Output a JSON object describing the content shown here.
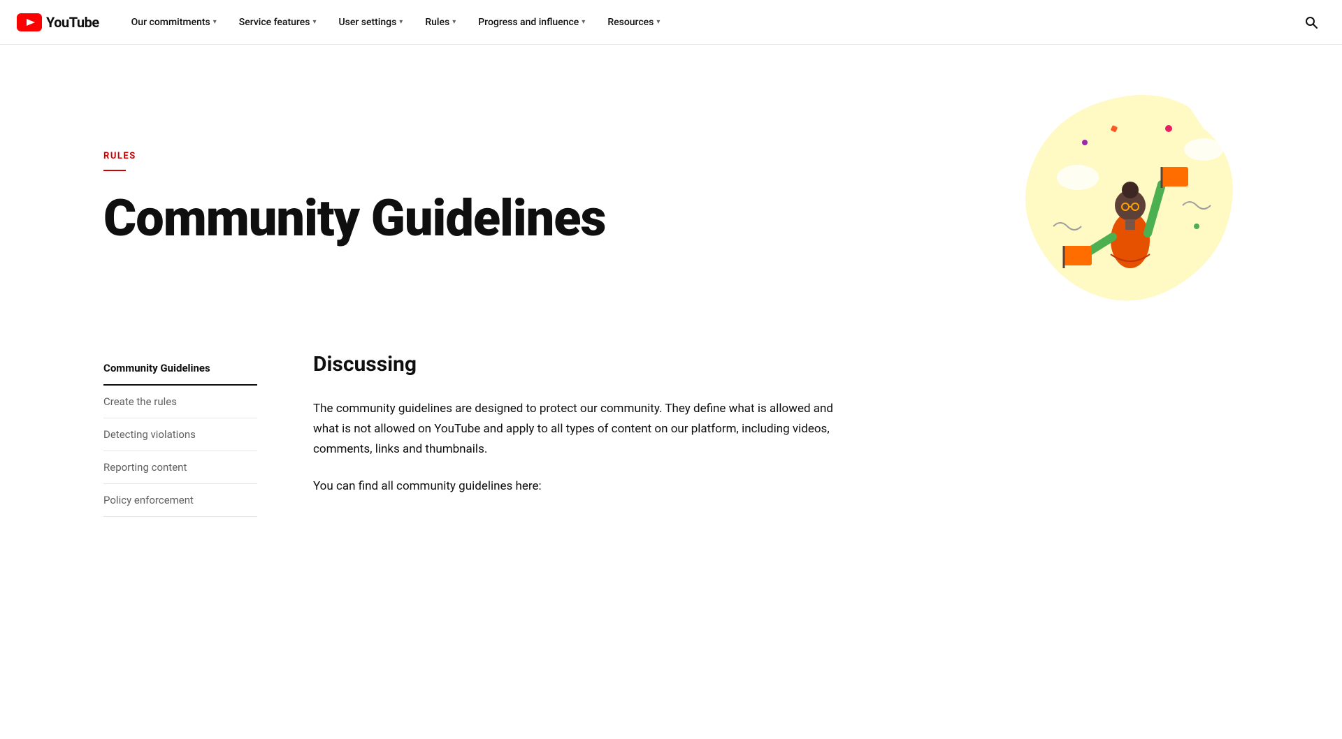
{
  "logo": {
    "text": "YouTube"
  },
  "nav": {
    "items": [
      {
        "label": "Our commitments",
        "hasChevron": true
      },
      {
        "label": "Service features",
        "hasChevron": true
      },
      {
        "label": "User settings",
        "hasChevron": true
      },
      {
        "label": "Rules",
        "hasChevron": true
      },
      {
        "label": "Progress and influence",
        "hasChevron": true
      },
      {
        "label": "Resources",
        "hasChevron": true
      }
    ]
  },
  "hero": {
    "rules_label": "RULES",
    "title": "Community Guidelines"
  },
  "sidebar": {
    "items": [
      {
        "label": "Community Guidelines",
        "active": true
      },
      {
        "label": "Create the rules",
        "active": false
      },
      {
        "label": "Detecting violations",
        "active": false
      },
      {
        "label": "Reporting content",
        "active": false
      },
      {
        "label": "Policy enforcement",
        "active": false
      }
    ]
  },
  "article": {
    "section_title": "Discussing",
    "paragraphs": [
      "The community guidelines are designed to protect our community. They define what is allowed and what is not allowed on YouTube and apply to all types of content on our platform, including videos, comments, links and thumbnails.",
      "You can find all community guidelines here:"
    ]
  }
}
